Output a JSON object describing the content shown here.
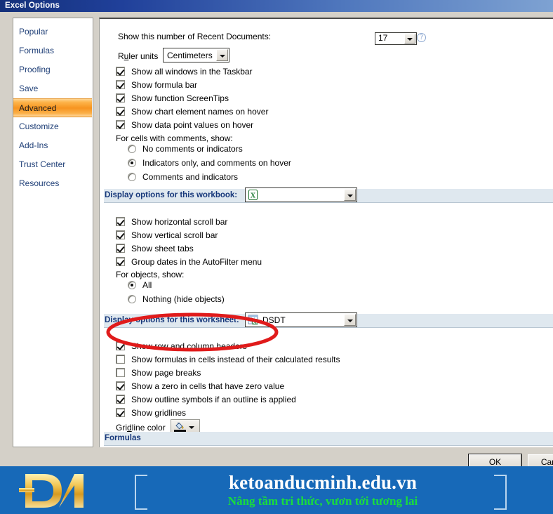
{
  "window": {
    "title": "Excel Options"
  },
  "sidebar": {
    "items": [
      {
        "label": "Popular",
        "selected": false
      },
      {
        "label": "Formulas",
        "selected": false
      },
      {
        "label": "Proofing",
        "selected": false
      },
      {
        "label": "Save",
        "selected": false
      },
      {
        "label": "Advanced",
        "selected": true
      },
      {
        "label": "Customize",
        "selected": false
      },
      {
        "label": "Add-Ins",
        "selected": false
      },
      {
        "label": "Trust Center",
        "selected": false
      },
      {
        "label": "Resources",
        "selected": false
      }
    ]
  },
  "display_section": {
    "recent_documents_label": "Show this number of Recent Documents:",
    "recent_documents_value": "17",
    "ruler_units_label": "Ruler units",
    "ruler_units_value": "Centimeters",
    "checkboxes": [
      {
        "label": "Show all windows in the Taskbar",
        "checked": true
      },
      {
        "label": "Show formula bar",
        "checked": true
      },
      {
        "label": "Show function ScreenTips",
        "checked": true
      },
      {
        "label": "Show chart element names on hover",
        "checked": true
      },
      {
        "label": "Show data point values on hover",
        "checked": true
      }
    ],
    "comments_group_label": "For cells with comments, show:",
    "comments_options": [
      {
        "label": "No comments or indicators",
        "selected": false
      },
      {
        "label": "Indicators only, and comments on hover",
        "selected": true
      },
      {
        "label": "Comments and indicators",
        "selected": false
      }
    ]
  },
  "workbook_section": {
    "header": "Display options for this workbook:",
    "selected_workbook": "",
    "checkboxes": [
      {
        "label": "Show horizontal scroll bar",
        "checked": true
      },
      {
        "label": "Show vertical scroll bar",
        "checked": true
      },
      {
        "label": "Show sheet tabs",
        "checked": true
      },
      {
        "label": "Group dates in the AutoFilter menu",
        "checked": true
      }
    ],
    "objects_group_label": "For objects, show:",
    "objects_options": [
      {
        "label": "All",
        "selected": true
      },
      {
        "label": "Nothing (hide objects)",
        "selected": false
      }
    ]
  },
  "worksheet_section": {
    "header": "Display options for this worksheet:",
    "selected_worksheet": "DSDT",
    "checkboxes": [
      {
        "label": "Show row and column headers",
        "checked": true
      },
      {
        "label": "Show formulas in cells instead of their calculated results",
        "checked": false
      },
      {
        "label": "Show page breaks",
        "checked": false
      },
      {
        "label": "Show a zero in cells that have zero value",
        "checked": true
      },
      {
        "label": "Show outline symbols if an outline is applied",
        "checked": true
      },
      {
        "label": "Show gridlines",
        "checked": true
      }
    ],
    "gridline_color_label": "Gridline color"
  },
  "formulas_section": {
    "header": "Formulas"
  },
  "footer": {
    "ok_label": "OK",
    "cancel_label": "Cancel"
  },
  "annotation": {
    "shape": "red-ellipse-highlight",
    "color": "#e01b1b",
    "targets": "Show row and column headers"
  },
  "banner": {
    "logo_text": "DM",
    "site": "ketoanducminh.edu.vn",
    "slogan": "Nâng tầm tri thức, vươn tới tương lai",
    "bg_color": "#1769b8",
    "slogan_color": "#19dd3c"
  }
}
